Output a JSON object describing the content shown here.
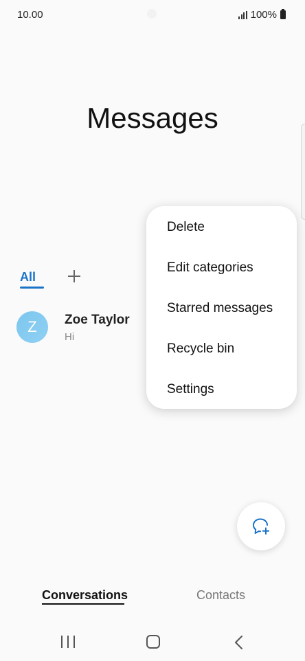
{
  "status_bar": {
    "time": "10.00",
    "battery": "100%"
  },
  "header": {
    "title": "Messages"
  },
  "categories": {
    "all_label": "All"
  },
  "conversations": [
    {
      "initial": "Z",
      "name": "Zoe Taylor",
      "preview": "Hi",
      "avatar_color": "#85cbf0"
    }
  ],
  "menu": {
    "items": [
      {
        "label": "Delete"
      },
      {
        "label": "Edit categories"
      },
      {
        "label": "Starred messages"
      },
      {
        "label": "Recycle bin"
      },
      {
        "label": "Settings"
      }
    ]
  },
  "bottom_tabs": {
    "conversations": "Conversations",
    "contacts": "Contacts"
  },
  "colors": {
    "accent": "#1a73c9",
    "background": "#fafafa"
  }
}
